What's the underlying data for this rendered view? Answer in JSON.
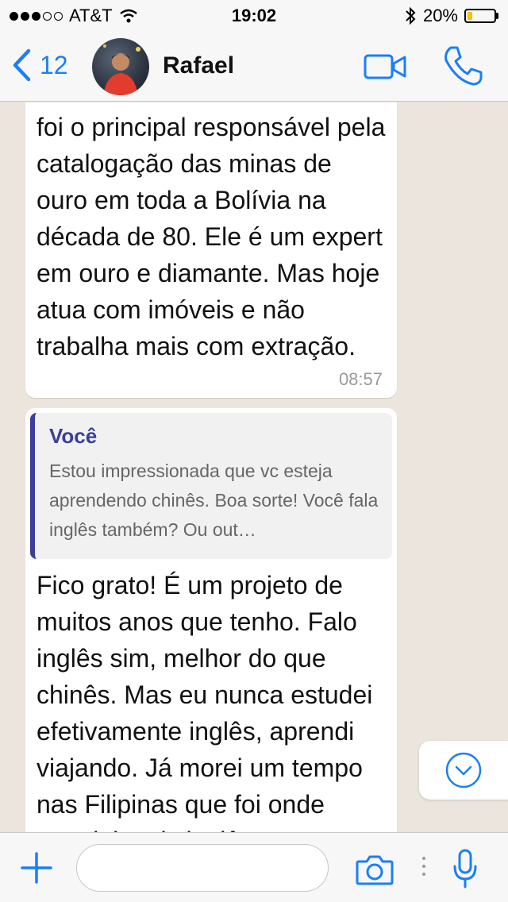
{
  "status_bar": {
    "carrier": "AT&T",
    "time": "19:02",
    "battery": "20%",
    "battery_level": 0.2
  },
  "header": {
    "back_count": "12",
    "contact_name": "Rafael"
  },
  "messages": [
    {
      "text": "foi o principal responsável pela catalogação das minas de ouro em toda a Bolívia na década de 80. Ele é um expert em ouro e diamante. Mas hoje atua com imóveis e não trabalha mais com extração.",
      "time": "08:57"
    },
    {
      "quote_author": "Você",
      "quote_text": "Estou impressionada que vc esteja aprendendo chinês. Boa sorte! Você fala inglês também? Ou out…",
      "text": "Fico grato! É um projeto de muitos anos que tenho. Falo inglês sim, melhor do que chinês. Mas eu nunca estudei efetivamente inglês, aprendi viajando. Já morei um tempo nas Filipinas que foi onde estudei mais inglês."
    }
  ],
  "input": {
    "placeholder": "",
    "value": ""
  },
  "colors": {
    "accent": "#1a7ff7",
    "quote_author": "#3b3f98",
    "chat_background": "#ece5dd"
  }
}
